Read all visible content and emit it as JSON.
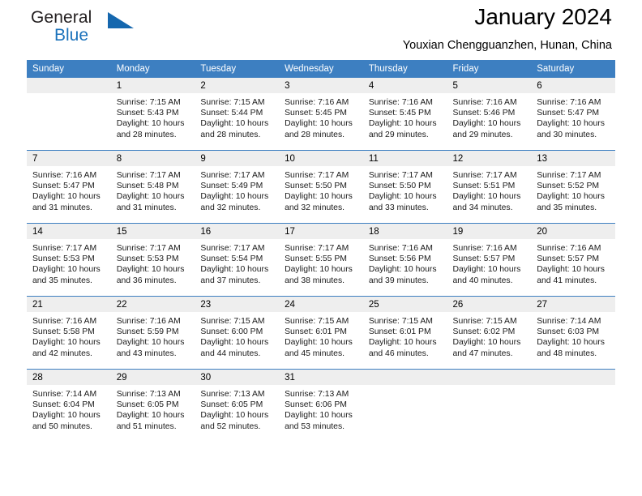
{
  "logo": {
    "primary_text": "General",
    "secondary_text": "Blue",
    "triangle_color": "#1567ae",
    "blue_color": "#1b72bb"
  },
  "header": {
    "title": "January 2024",
    "subtitle": "Youxian Chengguanzhen, Hunan, China",
    "accent_color": "#3d7fc1"
  },
  "calendar": {
    "weekday_headers": [
      "Sunday",
      "Monday",
      "Tuesday",
      "Wednesday",
      "Thursday",
      "Friday",
      "Saturday"
    ],
    "weeks": [
      [
        {
          "day": "",
          "sunrise": "",
          "sunset": "",
          "daylight_line1": "",
          "daylight_line2": "",
          "empty": true
        },
        {
          "day": "1",
          "sunrise": "Sunrise: 7:15 AM",
          "sunset": "Sunset: 5:43 PM",
          "daylight_line1": "Daylight: 10 hours",
          "daylight_line2": "and 28 minutes."
        },
        {
          "day": "2",
          "sunrise": "Sunrise: 7:15 AM",
          "sunset": "Sunset: 5:44 PM",
          "daylight_line1": "Daylight: 10 hours",
          "daylight_line2": "and 28 minutes."
        },
        {
          "day": "3",
          "sunrise": "Sunrise: 7:16 AM",
          "sunset": "Sunset: 5:45 PM",
          "daylight_line1": "Daylight: 10 hours",
          "daylight_line2": "and 28 minutes."
        },
        {
          "day": "4",
          "sunrise": "Sunrise: 7:16 AM",
          "sunset": "Sunset: 5:45 PM",
          "daylight_line1": "Daylight: 10 hours",
          "daylight_line2": "and 29 minutes."
        },
        {
          "day": "5",
          "sunrise": "Sunrise: 7:16 AM",
          "sunset": "Sunset: 5:46 PM",
          "daylight_line1": "Daylight: 10 hours",
          "daylight_line2": "and 29 minutes."
        },
        {
          "day": "6",
          "sunrise": "Sunrise: 7:16 AM",
          "sunset": "Sunset: 5:47 PM",
          "daylight_line1": "Daylight: 10 hours",
          "daylight_line2": "and 30 minutes."
        }
      ],
      [
        {
          "day": "7",
          "sunrise": "Sunrise: 7:16 AM",
          "sunset": "Sunset: 5:47 PM",
          "daylight_line1": "Daylight: 10 hours",
          "daylight_line2": "and 31 minutes."
        },
        {
          "day": "8",
          "sunrise": "Sunrise: 7:17 AM",
          "sunset": "Sunset: 5:48 PM",
          "daylight_line1": "Daylight: 10 hours",
          "daylight_line2": "and 31 minutes."
        },
        {
          "day": "9",
          "sunrise": "Sunrise: 7:17 AM",
          "sunset": "Sunset: 5:49 PM",
          "daylight_line1": "Daylight: 10 hours",
          "daylight_line2": "and 32 minutes."
        },
        {
          "day": "10",
          "sunrise": "Sunrise: 7:17 AM",
          "sunset": "Sunset: 5:50 PM",
          "daylight_line1": "Daylight: 10 hours",
          "daylight_line2": "and 32 minutes."
        },
        {
          "day": "11",
          "sunrise": "Sunrise: 7:17 AM",
          "sunset": "Sunset: 5:50 PM",
          "daylight_line1": "Daylight: 10 hours",
          "daylight_line2": "and 33 minutes."
        },
        {
          "day": "12",
          "sunrise": "Sunrise: 7:17 AM",
          "sunset": "Sunset: 5:51 PM",
          "daylight_line1": "Daylight: 10 hours",
          "daylight_line2": "and 34 minutes."
        },
        {
          "day": "13",
          "sunrise": "Sunrise: 7:17 AM",
          "sunset": "Sunset: 5:52 PM",
          "daylight_line1": "Daylight: 10 hours",
          "daylight_line2": "and 35 minutes."
        }
      ],
      [
        {
          "day": "14",
          "sunrise": "Sunrise: 7:17 AM",
          "sunset": "Sunset: 5:53 PM",
          "daylight_line1": "Daylight: 10 hours",
          "daylight_line2": "and 35 minutes."
        },
        {
          "day": "15",
          "sunrise": "Sunrise: 7:17 AM",
          "sunset": "Sunset: 5:53 PM",
          "daylight_line1": "Daylight: 10 hours",
          "daylight_line2": "and 36 minutes."
        },
        {
          "day": "16",
          "sunrise": "Sunrise: 7:17 AM",
          "sunset": "Sunset: 5:54 PM",
          "daylight_line1": "Daylight: 10 hours",
          "daylight_line2": "and 37 minutes."
        },
        {
          "day": "17",
          "sunrise": "Sunrise: 7:17 AM",
          "sunset": "Sunset: 5:55 PM",
          "daylight_line1": "Daylight: 10 hours",
          "daylight_line2": "and 38 minutes."
        },
        {
          "day": "18",
          "sunrise": "Sunrise: 7:16 AM",
          "sunset": "Sunset: 5:56 PM",
          "daylight_line1": "Daylight: 10 hours",
          "daylight_line2": "and 39 minutes."
        },
        {
          "day": "19",
          "sunrise": "Sunrise: 7:16 AM",
          "sunset": "Sunset: 5:57 PM",
          "daylight_line1": "Daylight: 10 hours",
          "daylight_line2": "and 40 minutes."
        },
        {
          "day": "20",
          "sunrise": "Sunrise: 7:16 AM",
          "sunset": "Sunset: 5:57 PM",
          "daylight_line1": "Daylight: 10 hours",
          "daylight_line2": "and 41 minutes."
        }
      ],
      [
        {
          "day": "21",
          "sunrise": "Sunrise: 7:16 AM",
          "sunset": "Sunset: 5:58 PM",
          "daylight_line1": "Daylight: 10 hours",
          "daylight_line2": "and 42 minutes."
        },
        {
          "day": "22",
          "sunrise": "Sunrise: 7:16 AM",
          "sunset": "Sunset: 5:59 PM",
          "daylight_line1": "Daylight: 10 hours",
          "daylight_line2": "and 43 minutes."
        },
        {
          "day": "23",
          "sunrise": "Sunrise: 7:15 AM",
          "sunset": "Sunset: 6:00 PM",
          "daylight_line1": "Daylight: 10 hours",
          "daylight_line2": "and 44 minutes."
        },
        {
          "day": "24",
          "sunrise": "Sunrise: 7:15 AM",
          "sunset": "Sunset: 6:01 PM",
          "daylight_line1": "Daylight: 10 hours",
          "daylight_line2": "and 45 minutes."
        },
        {
          "day": "25",
          "sunrise": "Sunrise: 7:15 AM",
          "sunset": "Sunset: 6:01 PM",
          "daylight_line1": "Daylight: 10 hours",
          "daylight_line2": "and 46 minutes."
        },
        {
          "day": "26",
          "sunrise": "Sunrise: 7:15 AM",
          "sunset": "Sunset: 6:02 PM",
          "daylight_line1": "Daylight: 10 hours",
          "daylight_line2": "and 47 minutes."
        },
        {
          "day": "27",
          "sunrise": "Sunrise: 7:14 AM",
          "sunset": "Sunset: 6:03 PM",
          "daylight_line1": "Daylight: 10 hours",
          "daylight_line2": "and 48 minutes."
        }
      ],
      [
        {
          "day": "28",
          "sunrise": "Sunrise: 7:14 AM",
          "sunset": "Sunset: 6:04 PM",
          "daylight_line1": "Daylight: 10 hours",
          "daylight_line2": "and 50 minutes."
        },
        {
          "day": "29",
          "sunrise": "Sunrise: 7:13 AM",
          "sunset": "Sunset: 6:05 PM",
          "daylight_line1": "Daylight: 10 hours",
          "daylight_line2": "and 51 minutes."
        },
        {
          "day": "30",
          "sunrise": "Sunrise: 7:13 AM",
          "sunset": "Sunset: 6:05 PM",
          "daylight_line1": "Daylight: 10 hours",
          "daylight_line2": "and 52 minutes."
        },
        {
          "day": "31",
          "sunrise": "Sunrise: 7:13 AM",
          "sunset": "Sunset: 6:06 PM",
          "daylight_line1": "Daylight: 10 hours",
          "daylight_line2": "and 53 minutes."
        },
        {
          "day": "",
          "sunrise": "",
          "sunset": "",
          "daylight_line1": "",
          "daylight_line2": "",
          "empty": true
        },
        {
          "day": "",
          "sunrise": "",
          "sunset": "",
          "daylight_line1": "",
          "daylight_line2": "",
          "empty": true
        },
        {
          "day": "",
          "sunrise": "",
          "sunset": "",
          "daylight_line1": "",
          "daylight_line2": "",
          "empty": true
        }
      ]
    ]
  }
}
